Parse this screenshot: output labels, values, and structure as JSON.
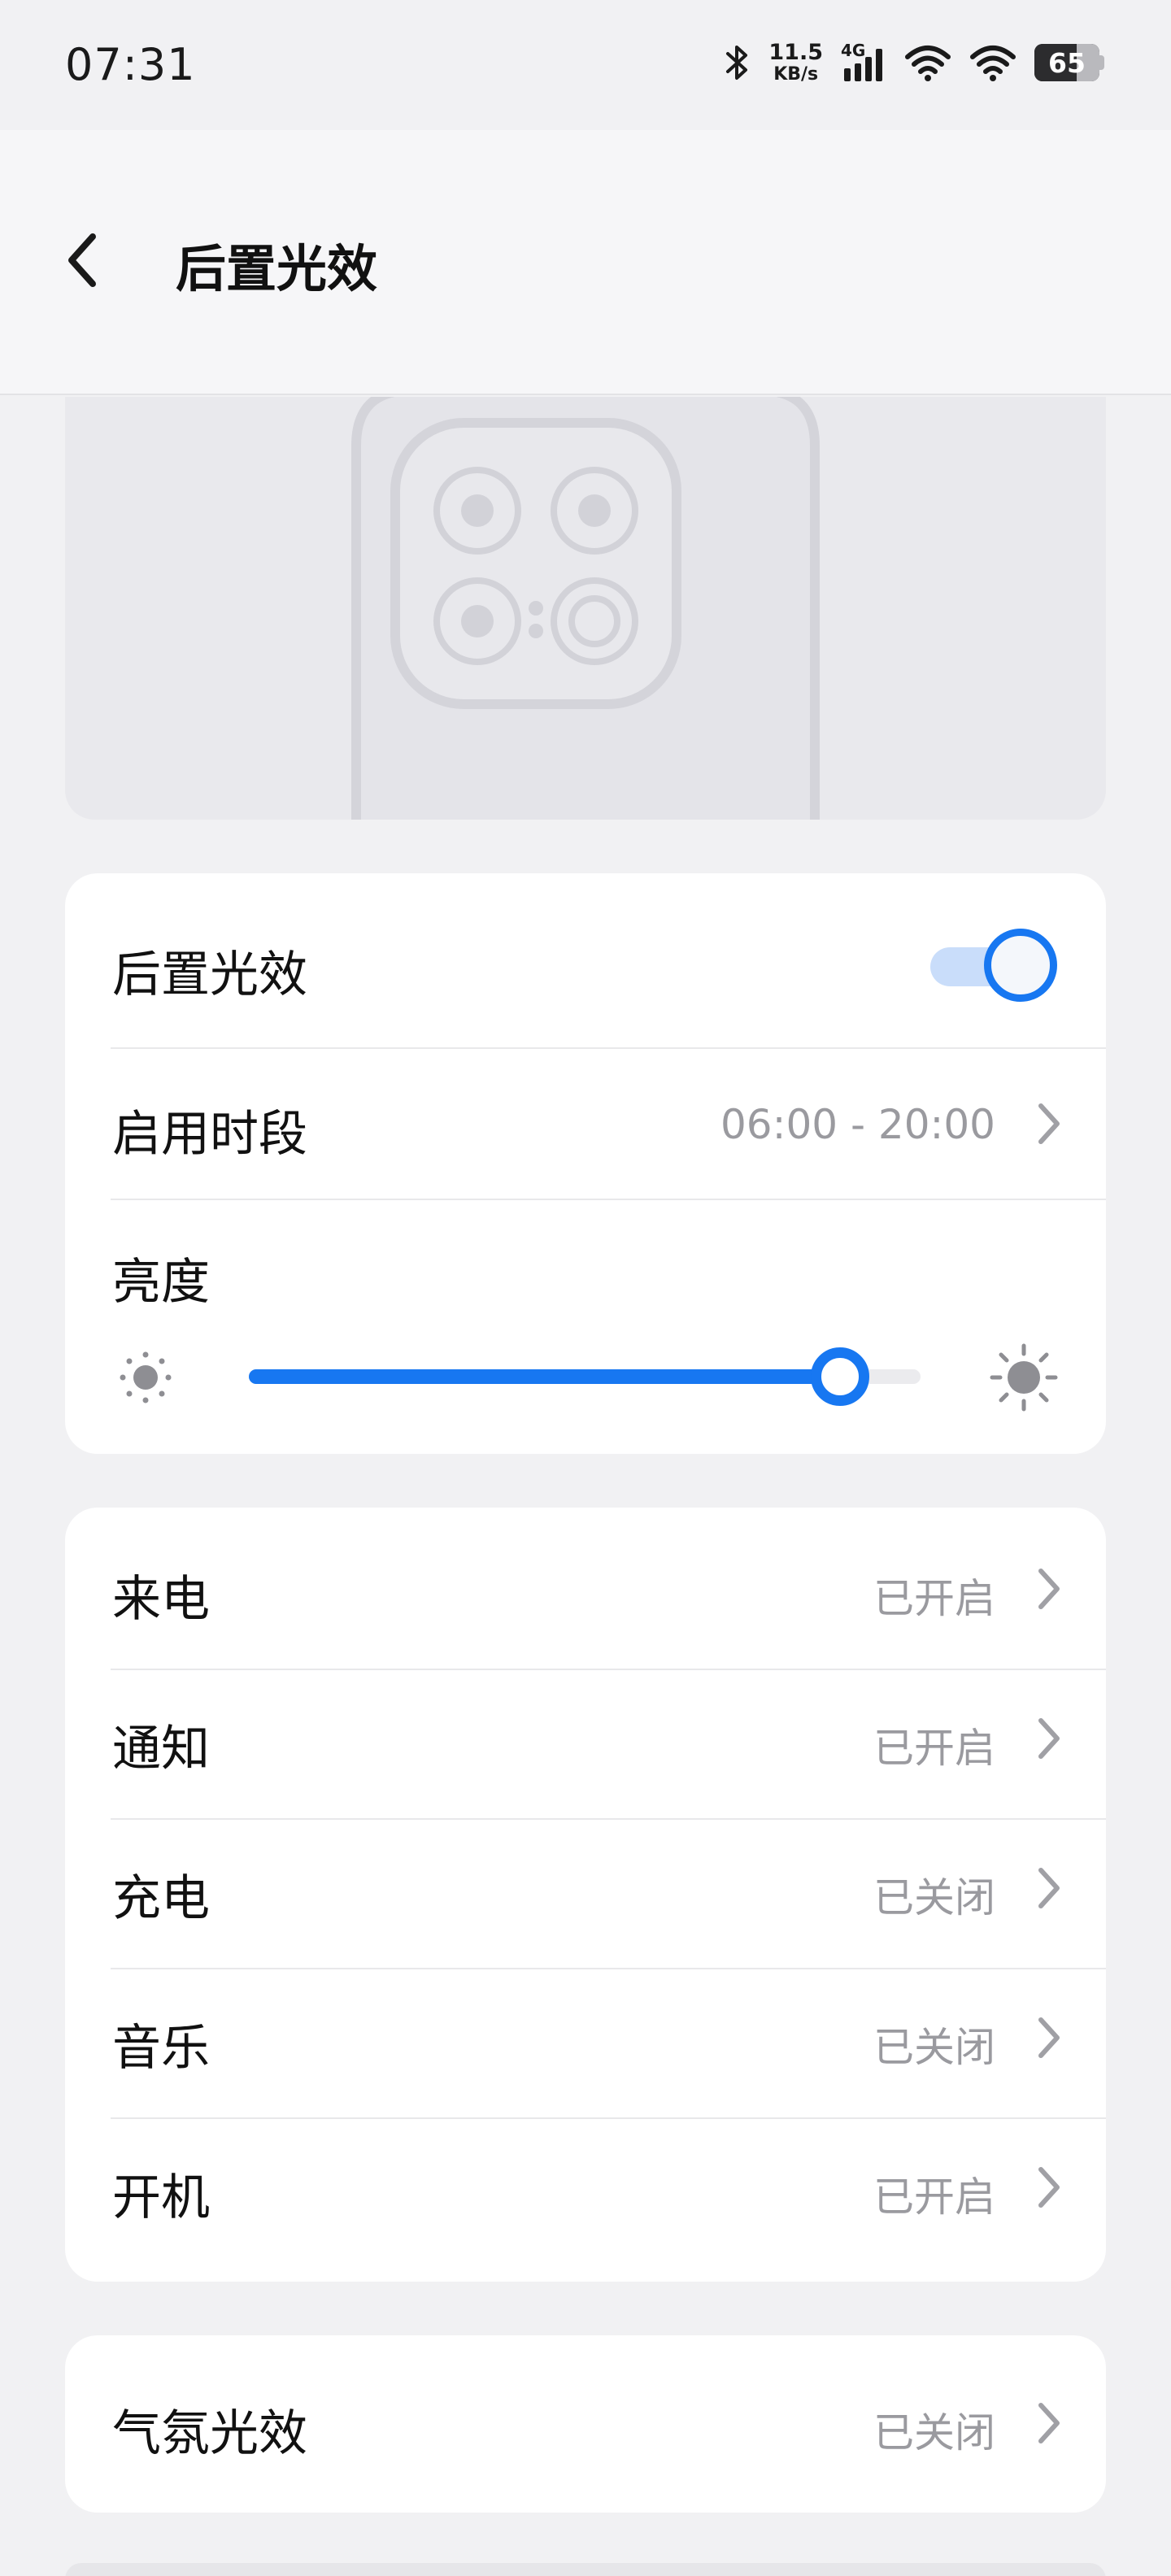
{
  "status_bar": {
    "time": "07:31",
    "net_speed_value": "11.5",
    "net_speed_unit": "KB/s",
    "network_type": "4G",
    "battery_level": "65",
    "icons": [
      "bluetooth-icon",
      "signal-icon",
      "wifi-icon",
      "wifi-icon",
      "battery-icon"
    ]
  },
  "header": {
    "title": "后置光效",
    "back_icon": "chevron-left-icon"
  },
  "main_card": {
    "toggle_label": "后置光效",
    "toggle_on": true,
    "schedule_label": "启用时段",
    "schedule_value": "06:00 - 20:00",
    "brightness_label": "亮度",
    "brightness_level": 0.88,
    "brightness_low_icon": "sun-dim-icon",
    "brightness_high_icon": "sun-bright-icon"
  },
  "events_card": {
    "items": [
      {
        "label": "来电",
        "value": "已开启"
      },
      {
        "label": "通知",
        "value": "已开启"
      },
      {
        "label": "充电",
        "value": "已关闭"
      },
      {
        "label": "音乐",
        "value": "已关闭"
      },
      {
        "label": "开机",
        "value": "已开启"
      }
    ]
  },
  "ambient_card": {
    "label": "气氛光效",
    "value": "已关闭"
  },
  "colors": {
    "accent": "#1777f1",
    "background": "#f1f1f3",
    "secondary_text": "#9a9a9f"
  }
}
